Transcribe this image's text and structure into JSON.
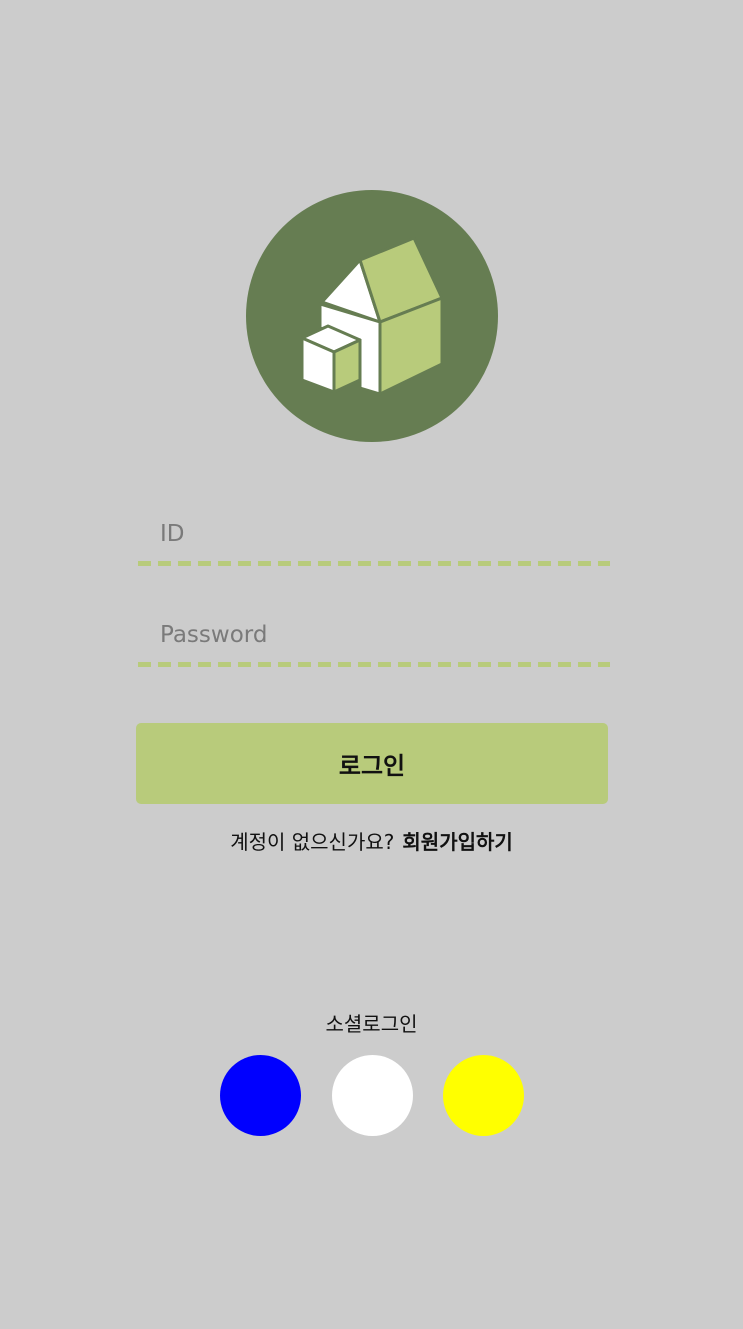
{
  "logo": {
    "icon": "house-blocks-icon",
    "background_color": "#667d52",
    "accent_color": "#b8cb7b"
  },
  "form": {
    "id_placeholder": "ID",
    "password_placeholder": "Password",
    "login_label": "로그인"
  },
  "signup": {
    "prompt": "계정이 없으신가요?",
    "link_label": "회원가입하기"
  },
  "social": {
    "title": "소셜로그인",
    "buttons": [
      {
        "color": "#0000ff"
      },
      {
        "color": "#ffffff"
      },
      {
        "color": "#ffff00"
      }
    ]
  }
}
